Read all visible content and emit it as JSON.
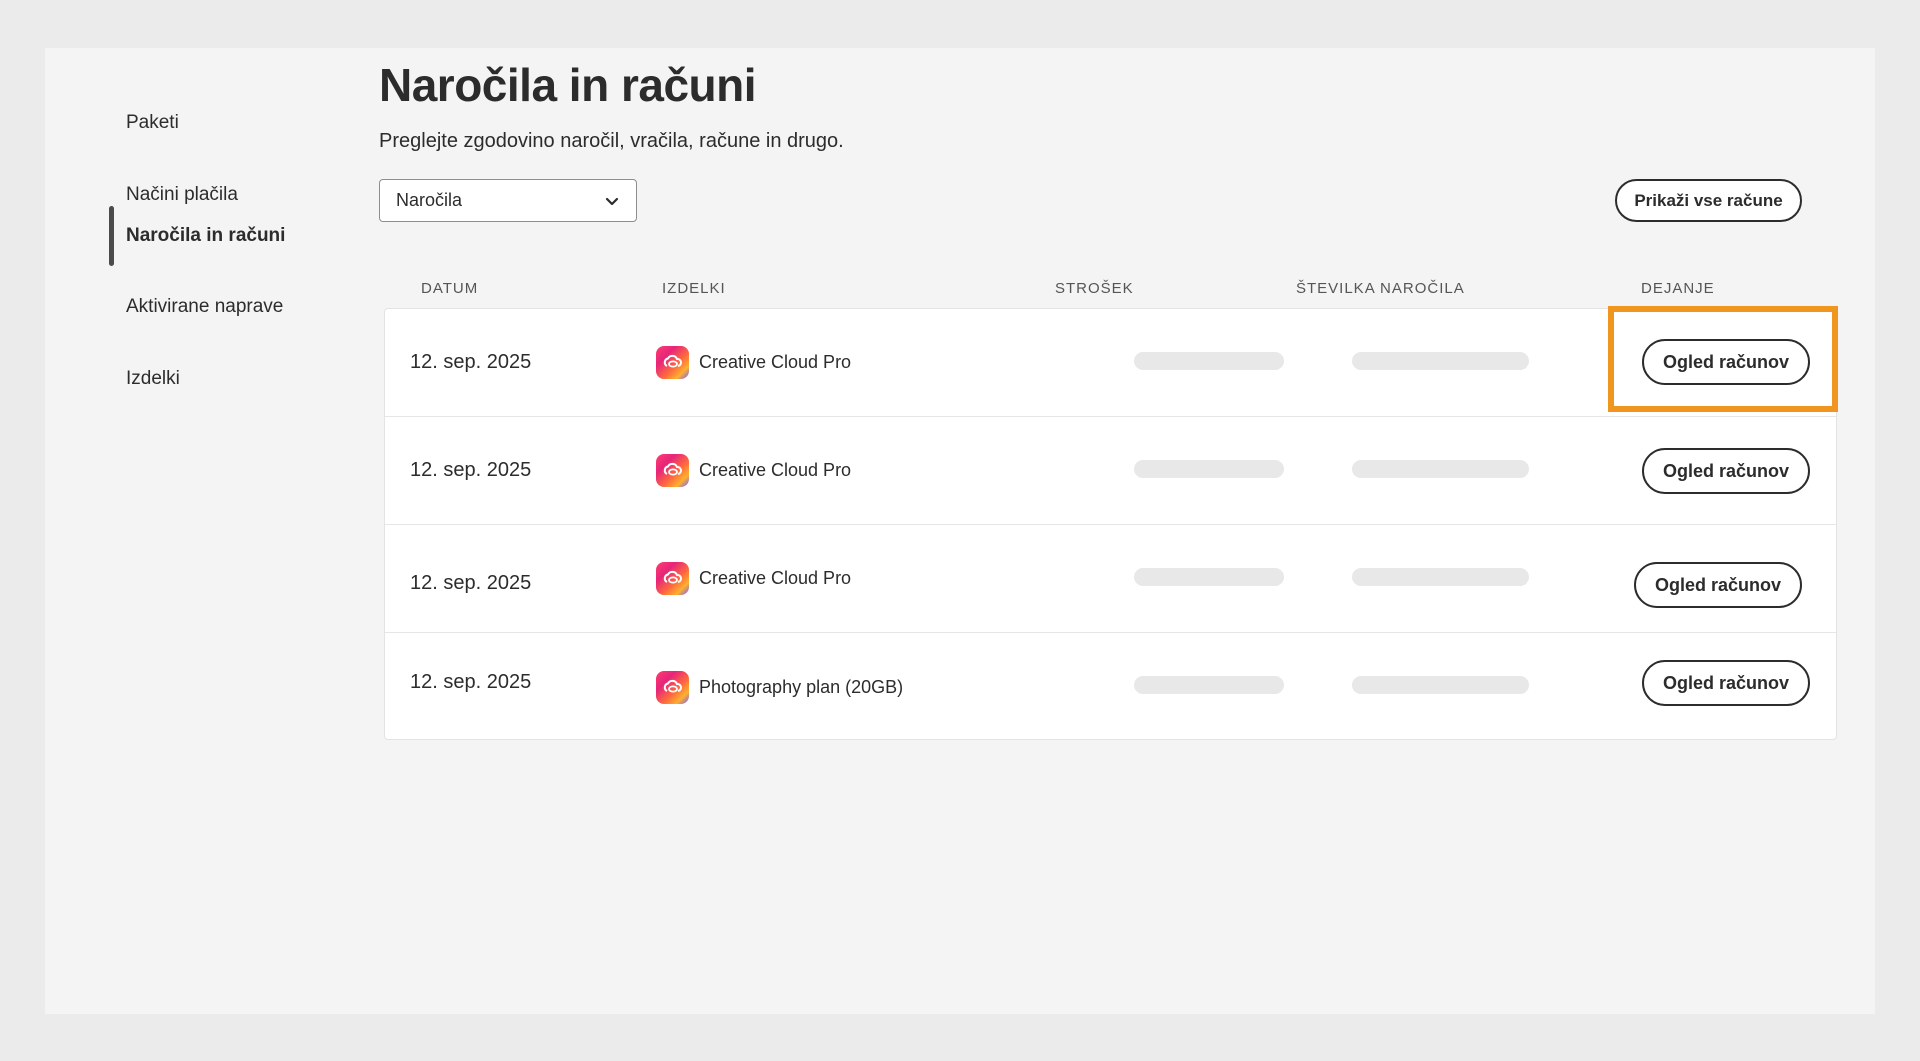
{
  "sidebar": {
    "items": [
      {
        "label": "Paketi"
      },
      {
        "label": "Načini plačila"
      },
      {
        "label": "Naročila in računi",
        "active": true
      },
      {
        "label": "Aktivirane naprave"
      },
      {
        "label": "Izdelki"
      }
    ]
  },
  "header": {
    "title": "Naročila in računi",
    "subtitle": "Preglejte zgodovino naročil, vračila, račune in drugo."
  },
  "filter": {
    "selected": "Naročila",
    "icon": "chevron-down-icon"
  },
  "actions": {
    "show_all_label": "Prikaži vse račune"
  },
  "table": {
    "columns": [
      "DATUM",
      "IZDELKI",
      "STROŠEK",
      "ŠTEVILKA NAROČILA",
      "DEJANJE"
    ],
    "rows": [
      {
        "date": "12. sep. 2025",
        "product": "Creative Cloud Pro",
        "action": "Ogled računov"
      },
      {
        "date": "12. sep. 2025",
        "product": "Creative Cloud Pro",
        "action": "Ogled računov"
      },
      {
        "date": "12. sep. 2025",
        "product": "Creative Cloud Pro",
        "action": "Ogled računov"
      },
      {
        "date": "12. sep. 2025",
        "product": "Photography plan (20GB)",
        "action": "Ogled računov"
      }
    ]
  },
  "colors": {
    "highlight": "#f0961e",
    "background": "#f4f4f4",
    "text": "#2c2c2c"
  }
}
